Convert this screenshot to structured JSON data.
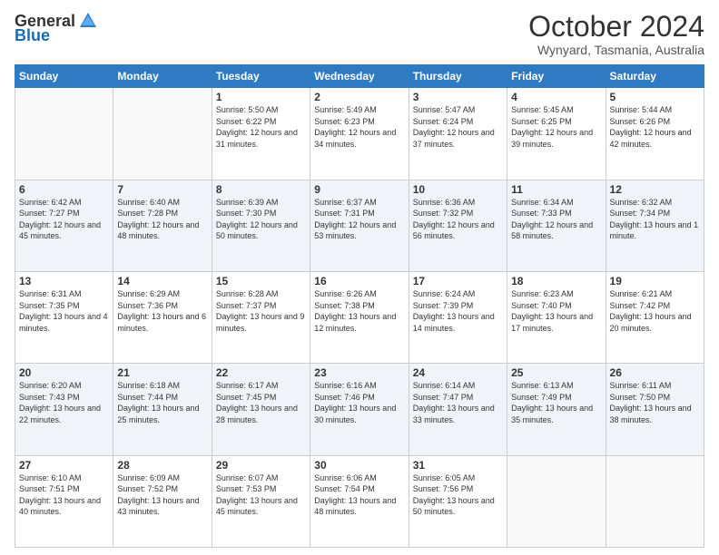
{
  "logo": {
    "general": "General",
    "blue": "Blue"
  },
  "header": {
    "month": "October 2024",
    "location": "Wynyard, Tasmania, Australia"
  },
  "weekdays": [
    "Sunday",
    "Monday",
    "Tuesday",
    "Wednesday",
    "Thursday",
    "Friday",
    "Saturday"
  ],
  "weeks": [
    [
      {
        "day": "",
        "info": ""
      },
      {
        "day": "",
        "info": ""
      },
      {
        "day": "1",
        "info": "Sunrise: 5:50 AM\nSunset: 6:22 PM\nDaylight: 12 hours and 31 minutes."
      },
      {
        "day": "2",
        "info": "Sunrise: 5:49 AM\nSunset: 6:23 PM\nDaylight: 12 hours and 34 minutes."
      },
      {
        "day": "3",
        "info": "Sunrise: 5:47 AM\nSunset: 6:24 PM\nDaylight: 12 hours and 37 minutes."
      },
      {
        "day": "4",
        "info": "Sunrise: 5:45 AM\nSunset: 6:25 PM\nDaylight: 12 hours and 39 minutes."
      },
      {
        "day": "5",
        "info": "Sunrise: 5:44 AM\nSunset: 6:26 PM\nDaylight: 12 hours and 42 minutes."
      }
    ],
    [
      {
        "day": "6",
        "info": "Sunrise: 6:42 AM\nSunset: 7:27 PM\nDaylight: 12 hours and 45 minutes."
      },
      {
        "day": "7",
        "info": "Sunrise: 6:40 AM\nSunset: 7:28 PM\nDaylight: 12 hours and 48 minutes."
      },
      {
        "day": "8",
        "info": "Sunrise: 6:39 AM\nSunset: 7:30 PM\nDaylight: 12 hours and 50 minutes."
      },
      {
        "day": "9",
        "info": "Sunrise: 6:37 AM\nSunset: 7:31 PM\nDaylight: 12 hours and 53 minutes."
      },
      {
        "day": "10",
        "info": "Sunrise: 6:36 AM\nSunset: 7:32 PM\nDaylight: 12 hours and 56 minutes."
      },
      {
        "day": "11",
        "info": "Sunrise: 6:34 AM\nSunset: 7:33 PM\nDaylight: 12 hours and 58 minutes."
      },
      {
        "day": "12",
        "info": "Sunrise: 6:32 AM\nSunset: 7:34 PM\nDaylight: 13 hours and 1 minute."
      }
    ],
    [
      {
        "day": "13",
        "info": "Sunrise: 6:31 AM\nSunset: 7:35 PM\nDaylight: 13 hours and 4 minutes."
      },
      {
        "day": "14",
        "info": "Sunrise: 6:29 AM\nSunset: 7:36 PM\nDaylight: 13 hours and 6 minutes."
      },
      {
        "day": "15",
        "info": "Sunrise: 6:28 AM\nSunset: 7:37 PM\nDaylight: 13 hours and 9 minutes."
      },
      {
        "day": "16",
        "info": "Sunrise: 6:26 AM\nSunset: 7:38 PM\nDaylight: 13 hours and 12 minutes."
      },
      {
        "day": "17",
        "info": "Sunrise: 6:24 AM\nSunset: 7:39 PM\nDaylight: 13 hours and 14 minutes."
      },
      {
        "day": "18",
        "info": "Sunrise: 6:23 AM\nSunset: 7:40 PM\nDaylight: 13 hours and 17 minutes."
      },
      {
        "day": "19",
        "info": "Sunrise: 6:21 AM\nSunset: 7:42 PM\nDaylight: 13 hours and 20 minutes."
      }
    ],
    [
      {
        "day": "20",
        "info": "Sunrise: 6:20 AM\nSunset: 7:43 PM\nDaylight: 13 hours and 22 minutes."
      },
      {
        "day": "21",
        "info": "Sunrise: 6:18 AM\nSunset: 7:44 PM\nDaylight: 13 hours and 25 minutes."
      },
      {
        "day": "22",
        "info": "Sunrise: 6:17 AM\nSunset: 7:45 PM\nDaylight: 13 hours and 28 minutes."
      },
      {
        "day": "23",
        "info": "Sunrise: 6:16 AM\nSunset: 7:46 PM\nDaylight: 13 hours and 30 minutes."
      },
      {
        "day": "24",
        "info": "Sunrise: 6:14 AM\nSunset: 7:47 PM\nDaylight: 13 hours and 33 minutes."
      },
      {
        "day": "25",
        "info": "Sunrise: 6:13 AM\nSunset: 7:49 PM\nDaylight: 13 hours and 35 minutes."
      },
      {
        "day": "26",
        "info": "Sunrise: 6:11 AM\nSunset: 7:50 PM\nDaylight: 13 hours and 38 minutes."
      }
    ],
    [
      {
        "day": "27",
        "info": "Sunrise: 6:10 AM\nSunset: 7:51 PM\nDaylight: 13 hours and 40 minutes."
      },
      {
        "day": "28",
        "info": "Sunrise: 6:09 AM\nSunset: 7:52 PM\nDaylight: 13 hours and 43 minutes."
      },
      {
        "day": "29",
        "info": "Sunrise: 6:07 AM\nSunset: 7:53 PM\nDaylight: 13 hours and 45 minutes."
      },
      {
        "day": "30",
        "info": "Sunrise: 6:06 AM\nSunset: 7:54 PM\nDaylight: 13 hours and 48 minutes."
      },
      {
        "day": "31",
        "info": "Sunrise: 6:05 AM\nSunset: 7:56 PM\nDaylight: 13 hours and 50 minutes."
      },
      {
        "day": "",
        "info": ""
      },
      {
        "day": "",
        "info": ""
      }
    ]
  ]
}
